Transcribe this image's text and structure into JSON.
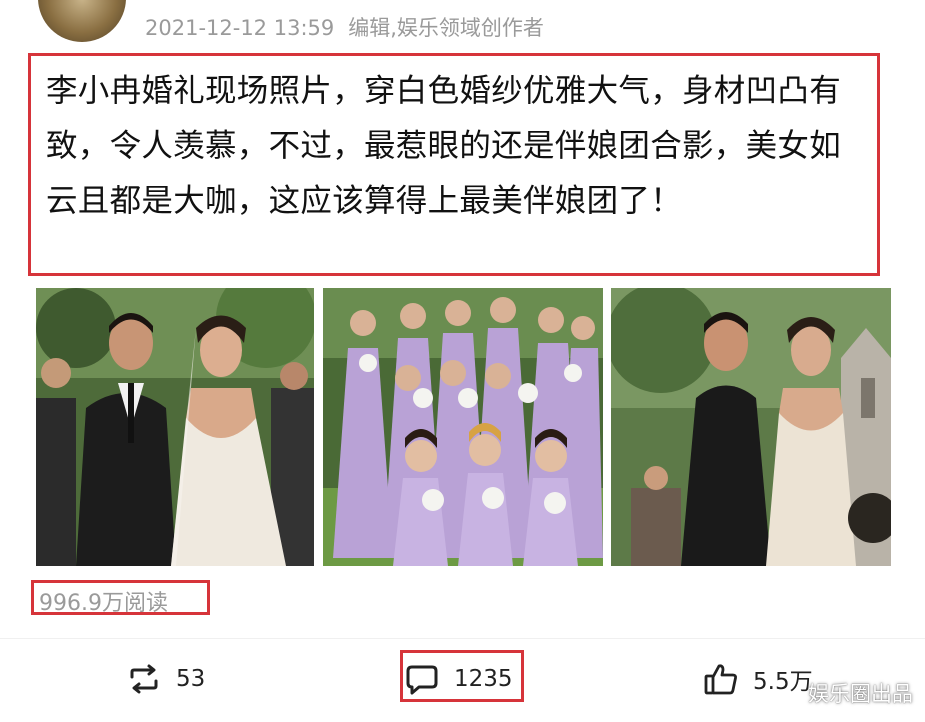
{
  "post": {
    "timestamp": "2021-12-12 13:59",
    "edit_tag": "编辑,娱乐领域创作者",
    "text": "李小冉婚礼现场照片，穿白色婚纱优雅大气，身材凹凸有致，令人羡慕，不过，最惹眼的还是伴娘团合影，美女如云且都是大咖，这应该算得上最美伴娘团了！",
    "reads": "996.9万阅读"
  },
  "actions": {
    "repost_count": "53",
    "comment_count": "1235",
    "like_count": "5.5万"
  },
  "watermark": "娱乐圈出品",
  "colors": {
    "highlight_border": "#d6343a",
    "meta_text": "#9a9a9a"
  }
}
